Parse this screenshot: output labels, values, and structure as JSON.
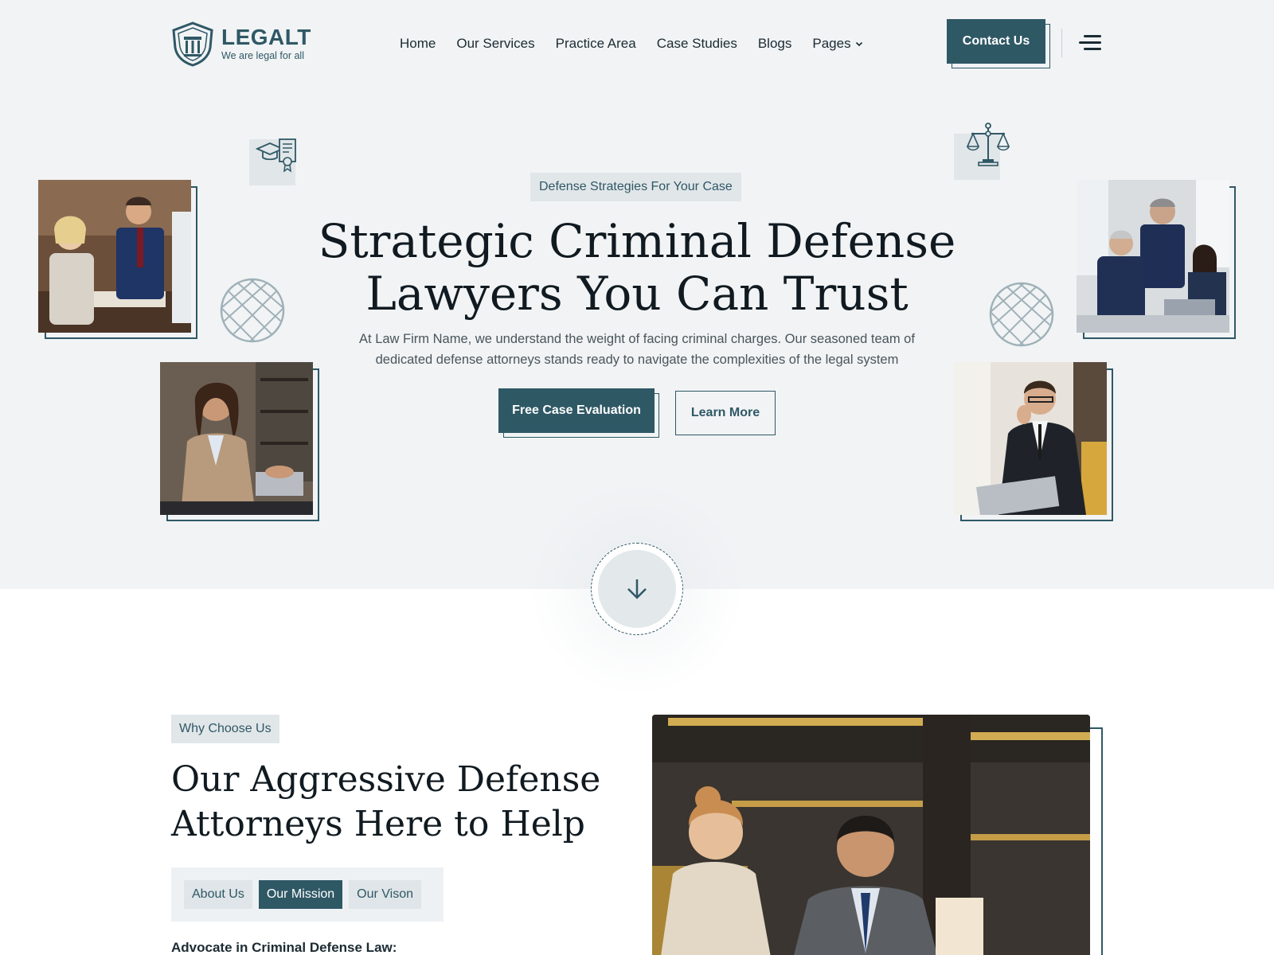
{
  "brand": {
    "name": "LEGALT",
    "tagline": "We are legal for all",
    "color": "#2f5865"
  },
  "nav": {
    "items": [
      "Home",
      "Our Services",
      "Practice Area",
      "Case Studies",
      "Blogs",
      "Pages"
    ],
    "contact_label": "Contact Us"
  },
  "hero": {
    "badge": "Defense Strategies For Your Case",
    "title_line1": "Strategic Criminal Defense",
    "title_line2": "Lawyers You Can Trust",
    "description": "At Law Firm Name, we understand the weight of facing criminal charges. Our seasoned team of dedicated defense attorneys stands ready to navigate the complexities of the legal system",
    "primary_cta": "Free Case Evaluation",
    "secondary_cta": "Learn More"
  },
  "why": {
    "badge": "Why Choose Us",
    "title_line1": "Our Aggressive Defense",
    "title_line2": "Attorneys Here to Help",
    "tabs": [
      "About Us",
      "Our Mission",
      "Our Vison"
    ],
    "active_tab": "Our Mission",
    "subheading": "Advocate in Criminal Defense Law:"
  },
  "icons": [
    "shield-logo-icon",
    "chevron-down-icon",
    "hamburger-menu-icon",
    "graduation-certificate-icon",
    "scales-of-justice-icon",
    "globe-pattern-icon",
    "arrow-down-icon"
  ]
}
